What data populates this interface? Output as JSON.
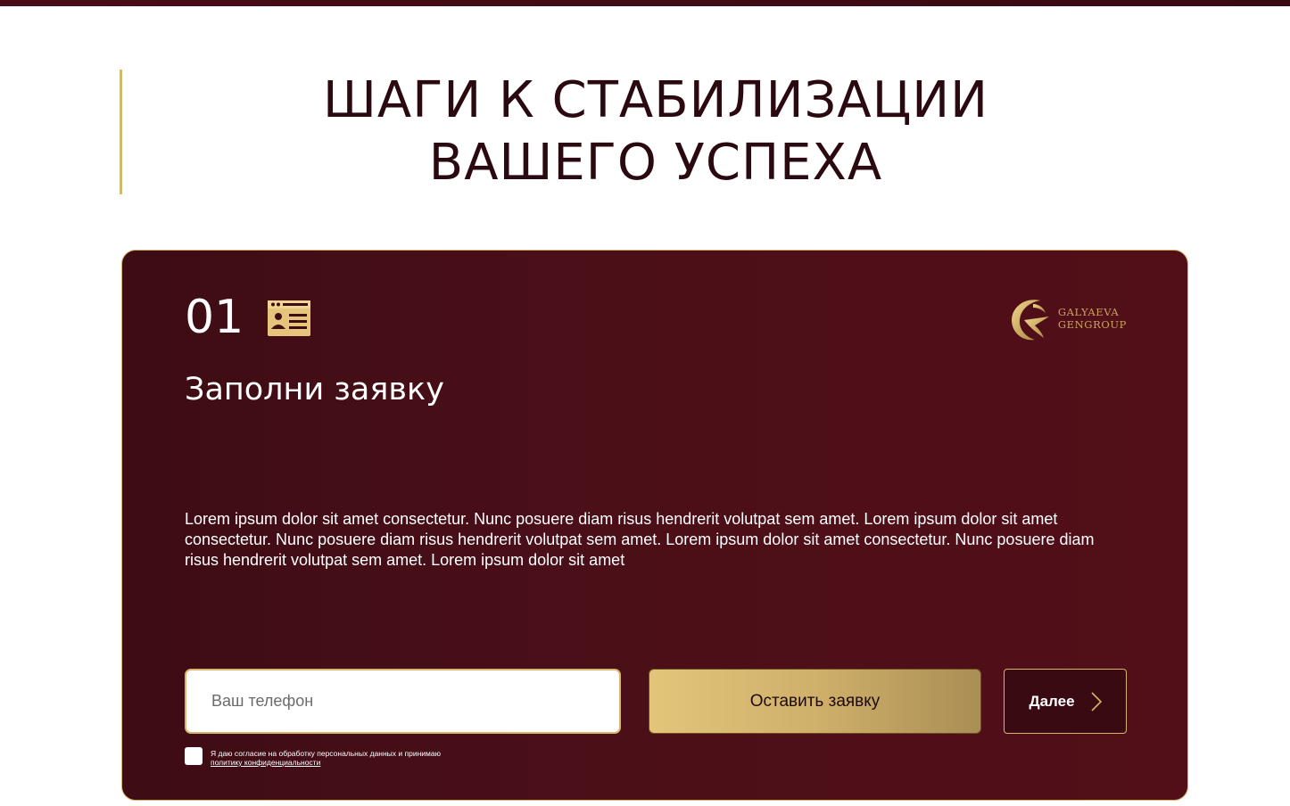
{
  "header": {
    "title_line1": "ШАГИ К СТАБИЛИЗАЦИИ",
    "title_line2": "ВАШЕГО УСПЕХА"
  },
  "card": {
    "step_number": "01",
    "step_icon": "id-card-icon",
    "title": "Заполни заявку",
    "description": "Lorem ipsum dolor sit amet consectetur. Nunc posuere diam risus hendrerit volutpat sem amet. Lorem ipsum dolor sit amet consectetur. Nunc posuere diam risus hendrerit volutpat sem amet. Lorem ipsum dolor sit amet consectetur. Nunc posuere diam risus hendrerit volutpat sem amet. Lorem ipsum dolor sit amet",
    "brand": {
      "line1": "GALYAEVA",
      "line2": "GENGROUP"
    }
  },
  "form": {
    "phone_placeholder": "Ваш телефон",
    "phone_value": "",
    "submit_label": "Оставить заявку",
    "next_label": "Далее",
    "consent_text": "Я даю согласие на обработку персональных данных и принимаю",
    "consent_link": "политику конфиденциальности",
    "consent_checked": false
  },
  "colors": {
    "burgundy": "#4a0f18",
    "gold": "#d7b46a",
    "title_text": "#2a0a10"
  }
}
